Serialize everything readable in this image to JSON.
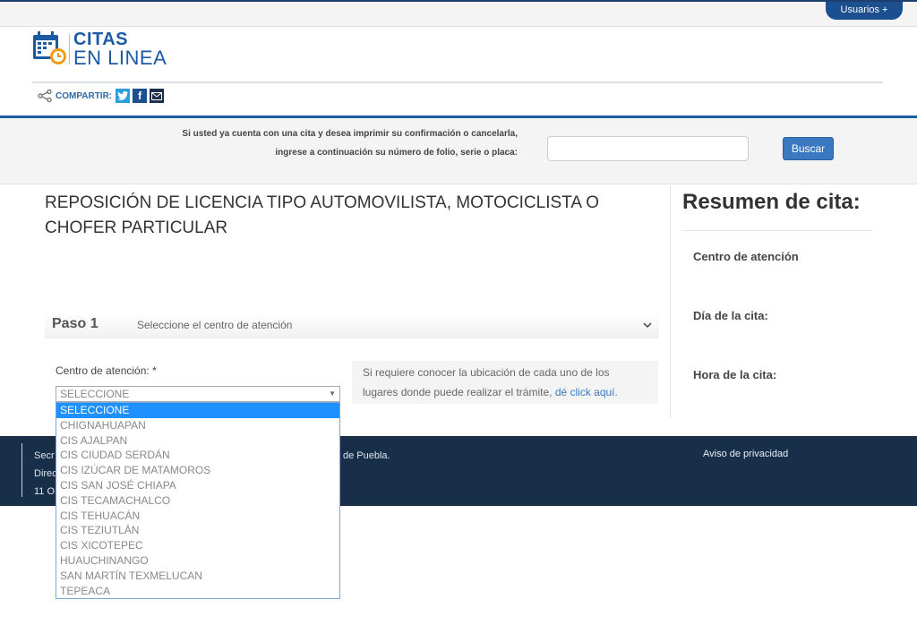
{
  "topbar": {
    "users_label": "Usuarios +"
  },
  "brand": {
    "line1": "CITAS",
    "line2": "EN LINEA"
  },
  "share": {
    "label": "COMPARTIR:",
    "icons": [
      "twitter-icon",
      "facebook-icon",
      "mail-icon"
    ]
  },
  "search": {
    "text_line1": "Si usted ya cuenta con una cita y desea imprimir su confirmación o cancelarla,",
    "text_line2": "ingrese a continuación su número de folio, serie o placa:",
    "input_value": "",
    "button_label": "Buscar"
  },
  "main": {
    "title": "REPOSICIÓN DE LICENCIA TIPO AUTOMOVILISTA, MOTOCICLISTA O CHOFER PARTICULAR",
    "step": {
      "number": "Paso 1",
      "description": "Seleccione el centro de atención"
    },
    "field_label": "Centro de atención: *",
    "select_value": "SELECCIONE",
    "options": [
      "SELECCIONE",
      "CHIGNAHUAPAN",
      "CIS AJALPAN",
      "CIS CIUDAD SERDÁN",
      "CIS IZÚCAR DE MATAMOROS",
      "CIS SAN JOSÉ CHIAPA",
      "CIS TECAMACHALCO",
      "CIS TEHUACÁN",
      "CIS TEZIUTLÁN",
      "CIS XICOTEPEC",
      "HUAUCHINANGO",
      "SAN MARTÍN TEXMELUCAN",
      "TEPEACA"
    ],
    "info_text": "Si requiere conocer la ubicación de cada uno de los lugares donde puede realizar el trámite,",
    "info_link": "dé click aquí."
  },
  "summary": {
    "title": "Resumen de cita:",
    "center_label": "Centro de atención",
    "day_label": "Día de la cita:",
    "time_label": "Hora de la cita:"
  },
  "footer": {
    "line1_start": "Secr",
    "line1_end": "de Puebla.",
    "line2": "Direc",
    "line3": "11 O",
    "privacy": "Aviso de privacidad"
  },
  "colors": {
    "brand_blue": "#1c5aa3",
    "footer_bg": "#182f4a",
    "highlight": "#1e90ff",
    "button_blue": "#3a78c2"
  }
}
